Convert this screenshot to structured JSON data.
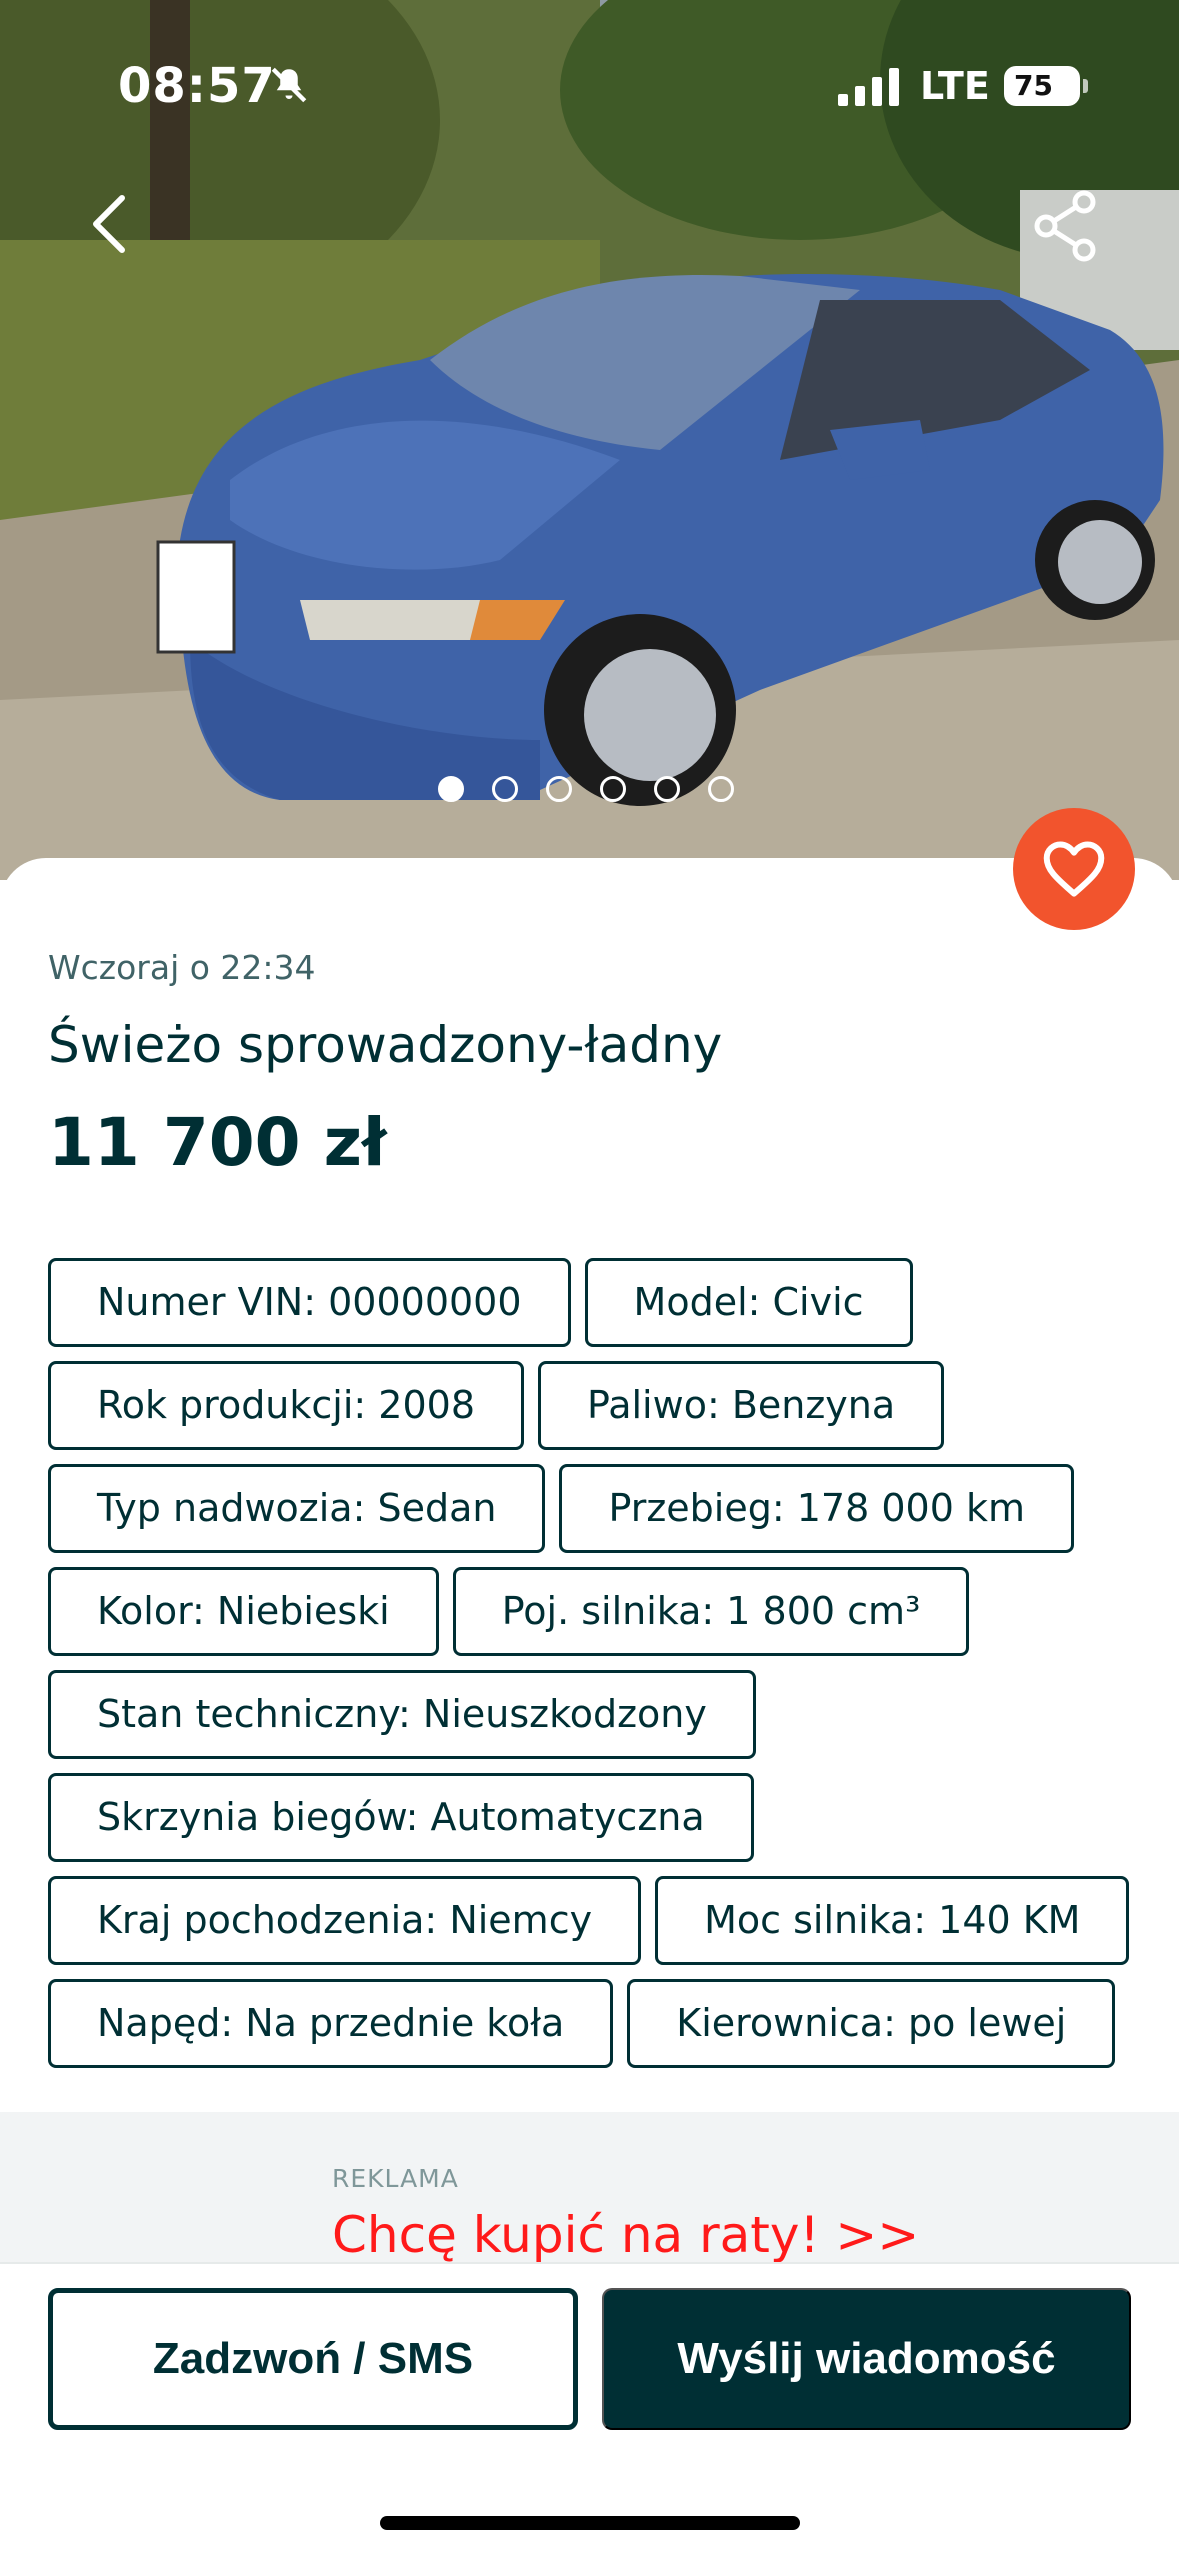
{
  "status_bar": {
    "time": "08:57",
    "bell_icon": "bell-slash-icon",
    "network": "LTE",
    "battery": "75",
    "battery_level": 0.75
  },
  "header": {
    "back_icon": "chevron-left-icon",
    "share_icon": "share-icon"
  },
  "gallery": {
    "photo_count": 6,
    "active_index": 0
  },
  "listing": {
    "posted": "Wczoraj o 22:34",
    "title": "Świeżo sprowadzony-ładny",
    "price": "11 700 zł",
    "favorite_icon": "heart-icon",
    "attributes": [
      "Numer VIN: 00000000",
      "Model: Civic",
      "Rok produkcji: 2008",
      "Paliwo: Benzyna",
      "Typ nadwozia: Sedan",
      "Przebieg: 178 000 km",
      "Kolor: Niebieski",
      "Poj. silnika: 1 800 cm³",
      "Stan techniczny: Nieuszkodzony",
      "Skrzynia biegów: Automatyczna",
      "Kraj pochodzenia: Niemcy",
      "Moc silnika: 140 KM",
      "Napęd: Na przednie koła",
      "Kierownica: po lewej"
    ]
  },
  "ad": {
    "label": "REKLAMA",
    "link_text": "Chcę kupić na raty! >>"
  },
  "actions": {
    "call_label": "Zadzwoń / SMS",
    "message_label": "Wyślij wiadomość"
  },
  "colors": {
    "primary": "#002f34",
    "favorite": "#f2542d",
    "ad_link": "#ff1a1a",
    "car_body": "#3f63a8"
  }
}
